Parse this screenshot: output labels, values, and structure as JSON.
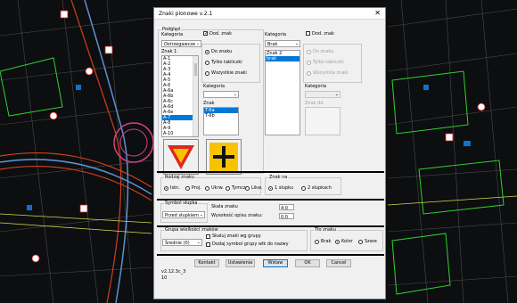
{
  "window": {
    "title": "Znaki pionowe v.2.1",
    "close_glyph": "✕"
  },
  "podglad": {
    "group_label": "Podgląd",
    "kategoria_label": "Kategoria",
    "dod_znak_label": "Dod. znak",
    "dod_znak_checked": true,
    "kategoria_value": "Ostrzegawcze",
    "znak_label": "Znak 1",
    "znak_items": [
      "A-1",
      "A-2",
      "A-3",
      "A-4",
      "A-5",
      "A-6",
      "A-6a",
      "A-6b",
      "A-6c",
      "A-6d",
      "A-6e",
      "A-7",
      "A-8",
      "A-9",
      "A-10"
    ],
    "znak_selected": "A-7",
    "radio_options": [
      "Do znaku",
      "Tylko tabliczki",
      "Wszystkie znaki"
    ],
    "radio_selected": "Do znaku",
    "kategoria2_label": "Kategoria",
    "kategoria2_value": "",
    "znak2_label": "Znak",
    "znak2_items": [
      "T-6a",
      "T-6b"
    ],
    "znak2_selected": "T-6a"
  },
  "right_panel": {
    "kategoria_label": "Kategoria",
    "dod_znak_label": "Dod. znak",
    "dod_znak_checked": false,
    "kategoria_value": "Brak",
    "znak_items": [
      "Znak 2",
      "brak"
    ],
    "znak_selected": "brak",
    "radio_options": [
      "Do znaku",
      "Tylko tabliczki",
      "Wszystkie znaki"
    ],
    "kategoria2_label": "Kategoria",
    "znak_dd_label": "Znak dd"
  },
  "rodzaj": {
    "group_label": "Rodzaj znaku",
    "options": [
      "Istn.",
      "Proj.",
      "Ukrw.",
      "Tymcz.",
      "Likw."
    ],
    "selected": "Istn."
  },
  "znak_na": {
    "group_label": "Znak na",
    "options": [
      "1 słupku",
      "2 słupkach"
    ],
    "selected": "1 słupku"
  },
  "symbol": {
    "group_label": "Symbol słupka",
    "value": "Przed słupkiem",
    "skala_label": "Skala znaku",
    "skala_value": "4.0",
    "wysokosc_label": "Wysokość opisu znaku:",
    "wysokosc_value": "0.0"
  },
  "grupa": {
    "group_label": "Grupa wielkości znaków",
    "value": "Średnie (0)",
    "chk1_label": "Skaluj znaki wg grupy",
    "chk2_label": "Dodaj symbol grupy wlk do nazwy"
  },
  "tlo": {
    "group_label": "Tło znaku",
    "options": [
      "Brak",
      "Kolor",
      "Szare"
    ],
    "selected": "Kolor"
  },
  "buttons": {
    "kontakt": "Kontakt",
    "ustawienia": "Ustawienia",
    "wstaw": "Wstaw",
    "ok": "OK",
    "cancel": "Cancel"
  },
  "version": "v2.12.3c_3",
  "version2": "10",
  "colors": {
    "sign_red": "#e0261d",
    "sign_yellow": "#f7c300",
    "selection": "#0078d7"
  }
}
